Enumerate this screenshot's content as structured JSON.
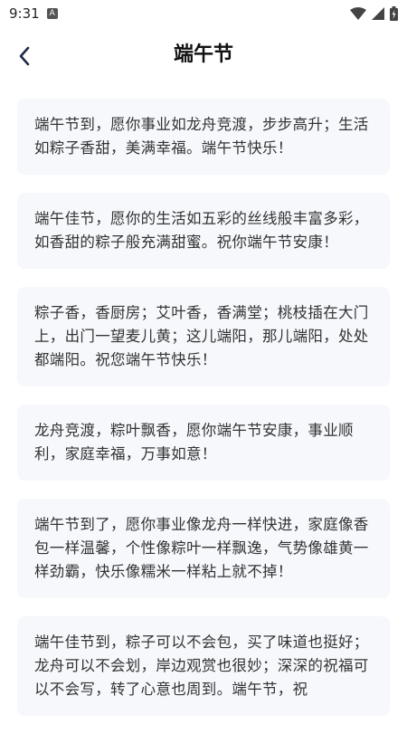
{
  "status": {
    "time": "9:31",
    "notif_badge": "A",
    "icons": [
      "wifi-icon",
      "signal-icon",
      "battery-icon"
    ]
  },
  "header": {
    "title": "端午节"
  },
  "greetings": [
    "端午节到，愿你事业如龙舟竞渡，步步高升；生活如粽子香甜，美满幸福。端午节快乐！",
    "端午佳节，愿你的生活如五彩的丝线般丰富多彩，如香甜的粽子般充满甜蜜。祝你端午节安康！",
    "粽子香，香厨房；艾叶香，香满堂；桃枝插在大门上，出门一望麦儿黄；这儿端阳，那儿端阳，处处都端阳。祝您端午节快乐！",
    "龙舟竞渡，粽叶飘香，愿你端午节安康，事业顺利，家庭幸福，万事如意！",
    "端午节到了，愿你事业像龙舟一样快进，家庭像香包一样温馨，个性像粽叶一样飘逸，气势像雄黄一样劲霸，快乐像糯米一样粘上就不掉！",
    "端午佳节到，粽子可以不会包，买了味道也挺好；龙舟可以不会划，岸边观赏也很妙；深深的祝福可以不会写，转了心意也周到。端午节，祝"
  ]
}
